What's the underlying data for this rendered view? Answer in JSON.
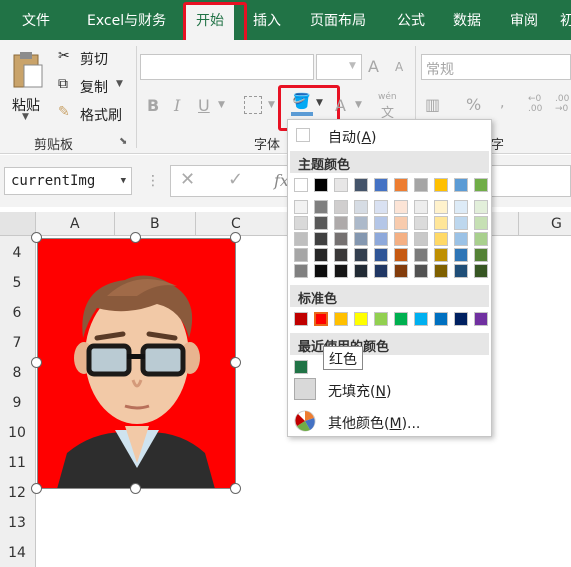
{
  "ribbon_tabs": [
    "文件",
    "Excel与财务",
    "开始",
    "插入",
    "页面布局",
    "公式",
    "数据",
    "审阅",
    "初"
  ],
  "clipboard": {
    "paste": "粘贴",
    "cut": "剪切",
    "copy": "复制",
    "format_painter": "格式刷",
    "group": "剪贴板"
  },
  "font": {
    "group": "字体",
    "bold": "B",
    "italic": "I",
    "underline": "U",
    "grow": "A",
    "shrink": "A",
    "wen": "wén",
    "wen_char": "文"
  },
  "number": {
    "format": "常规",
    "percent": "%",
    "group_partial": "字"
  },
  "namebox": "currentImg",
  "formula_fx": "fx",
  "columns": [
    "A",
    "B",
    "C",
    "G"
  ],
  "rows": [
    "4",
    "5",
    "6",
    "7",
    "8",
    "9",
    "10",
    "11",
    "12",
    "13",
    "14"
  ],
  "menu": {
    "auto_label": "自动(",
    "auto_key": "A",
    "auto_end": ")",
    "theme_title": "主题颜色",
    "theme_row": [
      "#ffffff",
      "#000000",
      "#e7e6e6",
      "#44546a",
      "#4472c4",
      "#ed7d31",
      "#a5a5a5",
      "#ffc000",
      "#5b9bd5",
      "#70ad47"
    ],
    "shades": [
      [
        "#f2f2f2",
        "#7f7f7f",
        "#d0cece",
        "#d6dce4",
        "#d9e1f2",
        "#fce4d6",
        "#ededed",
        "#fff2cc",
        "#ddebf7",
        "#e2efda"
      ],
      [
        "#d9d9d9",
        "#595959",
        "#aeaaaa",
        "#acb9ca",
        "#b4c6e7",
        "#f8cbad",
        "#dbdbdb",
        "#ffe699",
        "#bdd7ee",
        "#c6e0b4"
      ],
      [
        "#bfbfbf",
        "#404040",
        "#757171",
        "#8497b0",
        "#8ea9db",
        "#f4b084",
        "#c9c9c9",
        "#ffd966",
        "#9bc2e6",
        "#a9d08e"
      ],
      [
        "#a6a6a6",
        "#262626",
        "#3a3838",
        "#333f4f",
        "#2f5597",
        "#c65911",
        "#7b7b7b",
        "#bf8f00",
        "#2e75b6",
        "#548235"
      ],
      [
        "#808080",
        "#0d0d0d",
        "#161616",
        "#222b35",
        "#203764",
        "#833c0c",
        "#525252",
        "#7f6000",
        "#1f4e78",
        "#375623"
      ]
    ],
    "standard_title": "标准色",
    "standard": [
      "#c00000",
      "#ff0000",
      "#ffc000",
      "#ffff00",
      "#92d050",
      "#00b050",
      "#00b0f0",
      "#0070c0",
      "#002060",
      "#7030a0"
    ],
    "recent_title": "最近使用的颜色",
    "recent": [
      "#217346"
    ],
    "tooltip": "红色",
    "no_fill": "无填充(",
    "no_fill_key": "N",
    "no_fill_end": ")",
    "more": "其他颜色(",
    "more_key": "M",
    "more_end": ")..."
  },
  "colors": {
    "excel_green": "#217346",
    "highlight_red": "#e81123",
    "picture_bg": "#ff0000"
  }
}
